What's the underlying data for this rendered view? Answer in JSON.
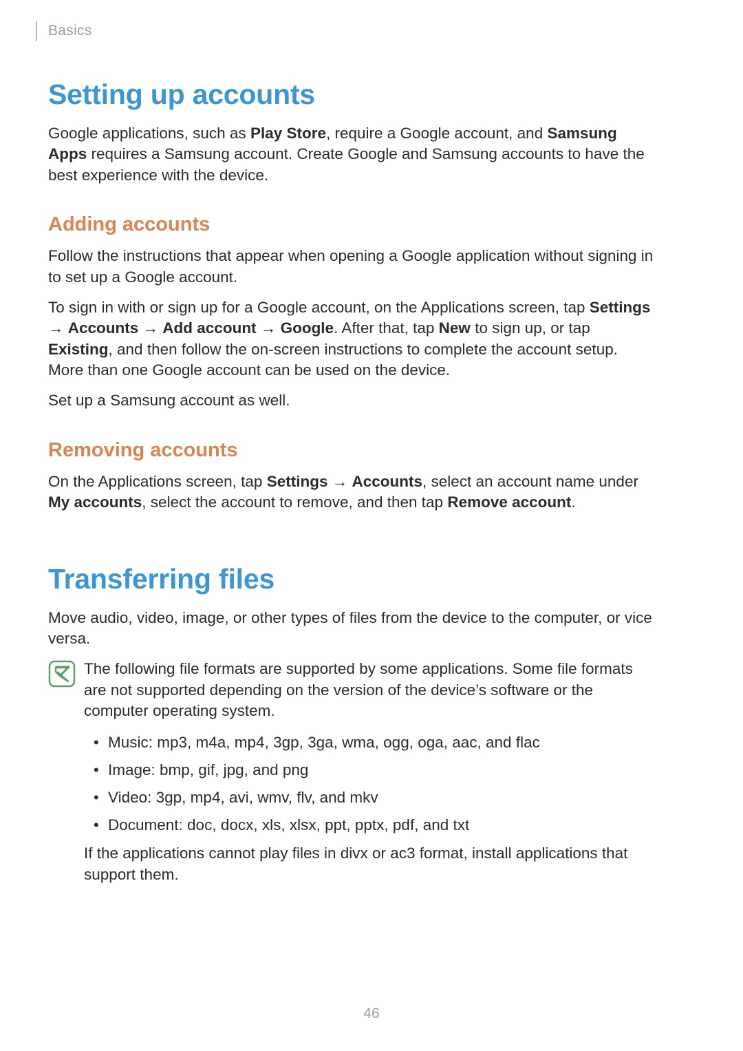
{
  "header": {
    "section": "Basics"
  },
  "h1a": "Setting up accounts",
  "p_intro": {
    "pre": "Google applications, such as ",
    "b1": "Play Store",
    "mid": ", require a Google account, and ",
    "b2": "Samsung Apps",
    "post": " requires a Samsung account. Create Google and Samsung accounts to have the best experience with the device."
  },
  "h2a": "Adding accounts",
  "p_add1": "Follow the instructions that appear when opening a Google application without signing in to set up a Google account.",
  "p_add2": {
    "t1": "To sign in with or sign up for a Google account, on the Applications screen, tap ",
    "b1": "Settings",
    "a1": " → ",
    "b2": "Accounts",
    "a2": " → ",
    "b3": "Add account",
    "a3": " → ",
    "b4": "Google",
    "t2": ". After that, tap ",
    "b5": "New",
    "t3": " to sign up, or tap ",
    "b6": "Existing",
    "t4": ", and then follow the on-screen instructions to complete the account setup. More than one Google account can be used on the device."
  },
  "p_add3": "Set up a Samsung account as well.",
  "h2b": "Removing accounts",
  "p_rem": {
    "t1": "On the Applications screen, tap ",
    "b1": "Settings",
    "a1": " → ",
    "b2": "Accounts",
    "t2": ", select an account name under ",
    "b3": "My accounts",
    "t3": ", select the account to remove, and then tap ",
    "b4": "Remove account",
    "t4": "."
  },
  "h1b": "Transferring files",
  "p_tf": "Move audio, video, image, or other types of files from the device to the computer, or vice versa.",
  "note": {
    "p1": "The following file formats are supported by some applications. Some file formats are not supported depending on the version of the device’s software or the computer operating system.",
    "formats": [
      "Music: mp3, m4a, mp4, 3gp, 3ga, wma, ogg, oga, aac, and flac",
      "Image: bmp, gif, jpg, and png",
      "Video: 3gp, mp4, avi, wmv, flv, and mkv",
      "Document: doc, docx, xls, xlsx, ppt, pptx, pdf, and txt"
    ],
    "p2": "If the applications cannot play files in divx or ac3 format, install applications that support them."
  },
  "page_number": "46"
}
